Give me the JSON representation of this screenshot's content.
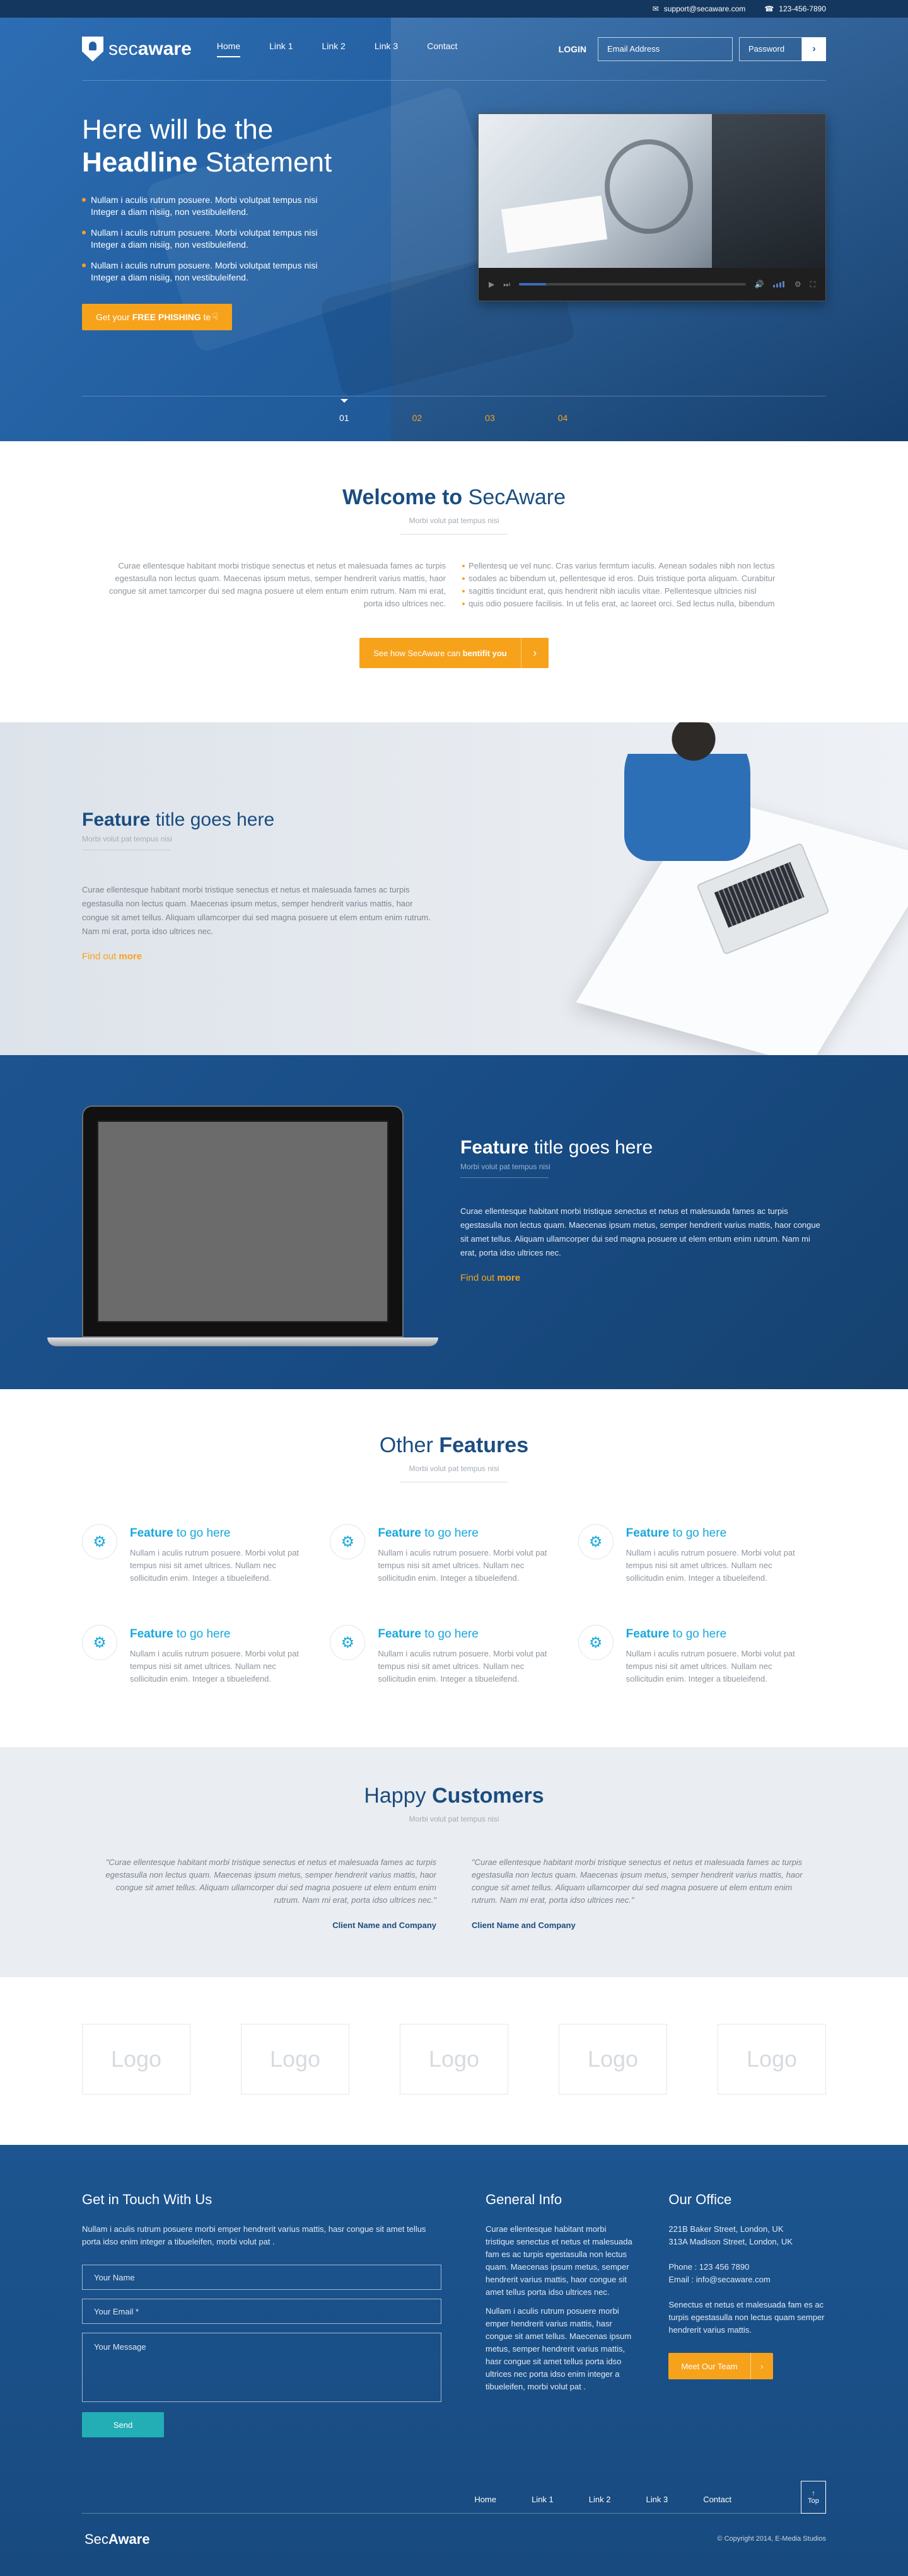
{
  "topbar": {
    "email": "support@secaware.com",
    "phone": "123-456-7890"
  },
  "brand": {
    "prefix": "sec",
    "suffix": "aware"
  },
  "nav": {
    "items": [
      "Home",
      "Link 1",
      "Link 2",
      "Link 3",
      "Contact"
    ],
    "login_label": "LOGIN",
    "email_placeholder": "Email Address",
    "password_placeholder": "Password",
    "go_icon": "chevron-right-icon"
  },
  "hero": {
    "headline_line1": "Here will be the",
    "headline_bold": "Headline",
    "headline_rest": "Statement",
    "bullets": [
      "Nullam i aculis rutrum posuere. Morbi volutpat tempus nisi Integer a diam nisiig, non vestibuleifend.",
      "Nullam i aculis rutrum posuere. Morbi volutpat tempus nisi Integer a diam nisiig, non vestibuleifend.",
      "Nullam i aculis rutrum posuere. Morbi volutpat tempus nisi Integer a diam nisiig, non vestibuleifend."
    ],
    "cta_prefix": "Get your",
    "cta_bold": "FREE PHISHING",
    "cta_suffix": "te",
    "slides": [
      "01",
      "02",
      "03",
      "04"
    ],
    "video_progress": 0.12
  },
  "welcome": {
    "title_prefix": "Welcome to",
    "title_rest": "SecAware",
    "subtitle": "Morbi volut pat tempus nisi",
    "left_text": "Curae ellentesque habitant morbi tristique senectus et netus et malesuada fames ac turpis egestasulla non lectus quam. Maecenas ipsum metus, semper hendrerit varius mattis, haor congue sit amet tamcorper dui sed magna posuere ut elem entum enim rutrum. Nam mi erat, porta idso ultrices nec.",
    "right_items": [
      "Pellentesq ue vel nunc. Cras varius fermtum iaculis. Aenean sodales nibh non lectus",
      "sodales ac bibendum ut, pellentesque id eros. Duis tristique porta aliquam. Curabitur",
      "sagittis tincidunt erat, quis hendrerit nibh iaculis vitae. Pellentesque ultricies nisl",
      "quis odio posuere facilisis. In ut felis erat, ac laoreet orci. Sed lectus nulla, bibendum"
    ],
    "button_prefix": "See how SecAware can",
    "button_bold": "bentifit you"
  },
  "feature1": {
    "title_bold": "Feature",
    "title_rest": "title goes here",
    "subtitle": "Morbi volut pat tempus nisi",
    "body": "Curae ellentesque habitant morbi tristique senectus et netus et malesuada fames ac turpis egestasulla non lectus quam. Maecenas ipsum metus, semper hendrerit varius mattis, haor congue sit amet tellus. Aliquam ullamcorper dui sed magna posuere ut elem entum enim rutrum. Nam mi erat, porta idso ultrices nec.",
    "link_prefix": "Find out",
    "link_bold": "more"
  },
  "feature2": {
    "title_bold": "Feature",
    "title_rest": "title goes here",
    "subtitle": "Morbi volut pat tempus nisi",
    "body": "Curae ellentesque habitant morbi tristique senectus et netus et malesuada fames ac turpis egestasulla non lectus quam. Maecenas ipsum metus, semper hendrerit varius mattis, haor congue sit amet tellus. Aliquam ullamcorper dui sed magna posuere ut elem entum enim rutrum. Nam mi erat, porta idso ultrices nec.",
    "link_prefix": "Find out",
    "link_bold": "more"
  },
  "other": {
    "title_prefix": "Other",
    "title_bold": "Features",
    "subtitle": "Morbi volut pat tempus nisi",
    "items": [
      {
        "bold": "Feature",
        "rest": "to go here",
        "text": "Nullam i aculis rutrum posuere. Morbi volut pat tempus nisi sit amet ultrices. Nullam nec sollicitudin enim. Integer a tibueleifend."
      },
      {
        "bold": "Feature",
        "rest": "to go here",
        "text": "Nullam i aculis rutrum posuere. Morbi volut pat tempus nisi sit amet ultrices. Nullam nec sollicitudin enim. Integer a tibueleifend."
      },
      {
        "bold": "Feature",
        "rest": "to go here",
        "text": "Nullam i aculis rutrum posuere. Morbi volut pat tempus nisi sit amet ultrices. Nullam nec sollicitudin enim. Integer a tibueleifend."
      },
      {
        "bold": "Feature",
        "rest": "to go here",
        "text": "Nullam i aculis rutrum posuere. Morbi volut pat tempus nisi sit amet ultrices. Nullam nec sollicitudin enim. Integer a tibueleifend."
      },
      {
        "bold": "Feature",
        "rest": "to go here",
        "text": "Nullam i aculis rutrum posuere. Morbi volut pat tempus nisi sit amet ultrices. Nullam nec sollicitudin enim. Integer a tibueleifend."
      },
      {
        "bold": "Feature",
        "rest": "to go here",
        "text": "Nullam i aculis rutrum posuere. Morbi volut pat tempus nisi sit amet ultrices. Nullam nec sollicitudin enim. Integer a tibueleifend."
      }
    ]
  },
  "testimonials": {
    "title_prefix": "Happy",
    "title_bold": "Customers",
    "subtitle": "Morbi volut pat tempus nisi",
    "quotes": [
      {
        "text": "\"Curae ellentesque habitant morbi tristique senectus et netus et malesuada fames ac turpis egestasulla non lectus quam. Maecenas ipsum metus, semper hendrerit varius mattis, haor congue sit amet tellus. Aliquam ullamcorper dui sed magna posuere ut elem entum enim rutrum. Nam mi erat, porta idso ultrices nec.\"",
        "name": "Client Name and Company"
      },
      {
        "text": "\"Curae ellentesque habitant morbi tristique senectus et netus et malesuada fames ac turpis egestasulla non lectus quam. Maecenas ipsum metus, semper hendrerit varius mattis, haor congue sit amet tellus. Aliquam ullamcorper dui sed magna posuere ut elem entum enim rutrum. Nam mi erat, porta idso ultrices nec.\"",
        "name": "Client Name and Company"
      }
    ]
  },
  "logos": [
    "Logo",
    "Logo",
    "Logo",
    "Logo",
    "Logo"
  ],
  "footer": {
    "contact_title": "Get in Touch With Us",
    "contact_text": "Nullam i aculis rutrum posuere morbi emper hendrerit varius mattis, hasr congue sit amet tellus porta idso enim integer a tibueleifen, morbi volut pat .",
    "name_placeholder": "Your Name",
    "email_placeholder": "Your Email *",
    "message_placeholder": "Your Message",
    "send_label": "Send",
    "info_title": "General Info",
    "info_text1": "Curae ellentesque habitant morbi tristique senectus et netus et malesuada fam es ac turpis egestasulla non lectus quam. Maecenas ipsum metus, semper hendrerit varius mattis, haor congue sit amet tellus porta idso ultrices nec.",
    "info_text2": "Nullam i aculis rutrum posuere morbi emper hendrerit varius mattis, hasr congue sit amet tellus. Maecenas ipsum metus, semper hendrerit varius mattis, hasr congue sit amet tellus porta idso ultrices nec porta idso enim integer a tibueleifen, morbi volut pat .",
    "office_title": "Our Office",
    "address1": "221B Baker Street, London, UK",
    "address2": "313A Madison Street, London, UK",
    "phone": "Phone : 123 456 7890",
    "email": "Email : info@secaware.com",
    "office_text": "Senectus et netus et malesuada fam es ac turpis egestasulla non lectus quam semper hendrerit varius mattis.",
    "team_label": "Meet Our Team",
    "menu": [
      "Home",
      "Link 1",
      "Link 2",
      "Link 3",
      "Contact"
    ],
    "logo_prefix": "Sec",
    "logo_bold": "Aware",
    "copyright": "© Copyright 2014, E-Media Studios",
    "top_label": "Top"
  },
  "colors": {
    "primary": "#1b4d80",
    "accent": "#f7a21b",
    "feature_blue": "#17a8dd",
    "teal": "#23aeb6"
  }
}
